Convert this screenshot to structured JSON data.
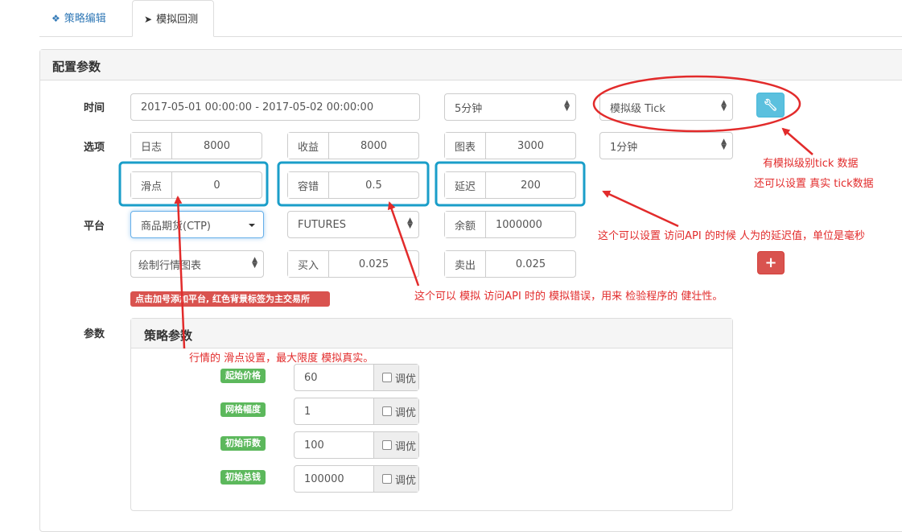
{
  "tabs": [
    {
      "label": "策略编辑",
      "icon": "cubes-icon"
    },
    {
      "label": "模拟回测",
      "icon": "rocket-icon"
    }
  ],
  "panel_title": "配置参数",
  "row_labels": {
    "time": "时间",
    "options": "选项",
    "platform": "平台",
    "params": "参数"
  },
  "time_range": "2017-05-01 00:00:00 - 2017-05-02 00:00:00",
  "period_select": "5分钟",
  "tick_mode_select": "模拟级 Tick",
  "options": {
    "log": {
      "label": "日志",
      "value": "8000"
    },
    "profit": {
      "label": "收益",
      "value": "8000"
    },
    "chart": {
      "label": "图表",
      "value": "3000"
    },
    "base_period_select": "1分钟",
    "slippage": {
      "label": "滑点",
      "value": "0"
    },
    "fault_tolerance": {
      "label": "容错",
      "value": "0.5"
    },
    "delay": {
      "label": "延迟",
      "value": "200"
    }
  },
  "platform": {
    "exchange_select": "商品期货(CTP)",
    "contract_select": "FUTURES",
    "balance": {
      "label": "余额",
      "value": "1000000"
    },
    "draw_chart_select": "绘制行情图表",
    "buy_fee": {
      "label": "买入",
      "value": "0.025"
    },
    "sell_fee": {
      "label": "卖出",
      "value": "0.025"
    },
    "hint": "点击加号添加平台, 红色背景标签为主交易所"
  },
  "strategy_params": {
    "title": "策略参数",
    "items": [
      {
        "label": "起始价格",
        "value": "60",
        "opt": "调优"
      },
      {
        "label": "网格幅度",
        "value": "1",
        "opt": "调优"
      },
      {
        "label": "初始币数",
        "value": "100",
        "opt": "调优"
      },
      {
        "label": "初始总钱",
        "value": "100000",
        "opt": "调优"
      }
    ]
  },
  "annotations": {
    "tick_line1": "有模拟级别tick 数据",
    "tick_line2": "还可以设置 真实 tick数据",
    "delay_note": "这个可以设置 访问API 的时候 人为的延迟值，单位是毫秒",
    "fault_note": "这个可以 模拟 访问API 时的  模拟错误，用来 检验程序的 健壮性。",
    "slippage_note": "行情的  滑点设置，最大限度 模拟真实。"
  },
  "colors": {
    "annotation": "#e22b2b",
    "highlight_box": "#1a9ec9",
    "info_button": "#5bc0de",
    "danger_button": "#d9534f",
    "param_badge": "#5cb85c"
  }
}
